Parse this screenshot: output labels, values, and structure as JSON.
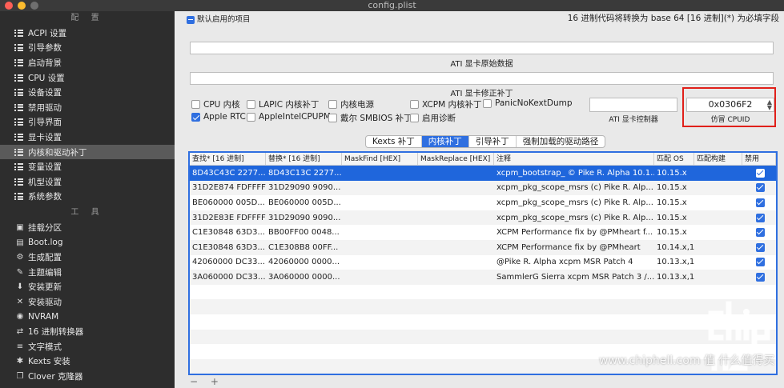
{
  "window": {
    "title": "config.plist"
  },
  "sidebar": {
    "section1_title": "配 置",
    "items": [
      {
        "label": "ACPI 设置"
      },
      {
        "label": "引导参数"
      },
      {
        "label": "启动背景"
      },
      {
        "label": "CPU 设置"
      },
      {
        "label": "设备设置"
      },
      {
        "label": "禁用驱动"
      },
      {
        "label": "引导界面"
      },
      {
        "label": "显卡设置"
      },
      {
        "label": "内核和驱动补丁",
        "active": true
      },
      {
        "label": "变量设置"
      },
      {
        "label": "机型设置"
      },
      {
        "label": "系统参数"
      }
    ],
    "section2_title": "工 具",
    "tools": [
      {
        "label": "挂载分区",
        "icon": "disk-icon"
      },
      {
        "label": "Boot.log",
        "icon": "document-icon"
      },
      {
        "label": "生成配置",
        "icon": "gears-icon"
      },
      {
        "label": "主题编辑",
        "icon": "palette-icon"
      },
      {
        "label": "安装更新",
        "icon": "download-icon"
      },
      {
        "label": "安装驱动",
        "icon": "wrench-icon"
      },
      {
        "label": "NVRAM",
        "icon": "chip-icon"
      },
      {
        "label": "16 进制转换器",
        "icon": "converter-icon"
      },
      {
        "label": "文字模式",
        "icon": "text-mode-icon"
      },
      {
        "label": "Kexts 安装",
        "icon": "kexts-icon"
      },
      {
        "label": "Clover 克隆器",
        "icon": "clone-icon"
      }
    ]
  },
  "topbar": {
    "default_items": "默认启用的项目",
    "hex_note": "16 进制代码将转换为 base 64 [16 进制](*) 为必填字段"
  },
  "ati": {
    "rom_caption": "ATI 显卡原始数据",
    "patch_caption": "ATI 显卡修正补丁",
    "controller_caption": "ATI 显卡控制器",
    "cpuid_caption": "仿冒 CPUID",
    "cpuid_value": "0x0306F2"
  },
  "options": [
    {
      "label": "CPU 内核",
      "checked": false
    },
    {
      "label": "LAPIC 内核补丁",
      "checked": false
    },
    {
      "label": "内核电源",
      "checked": false
    },
    {
      "label": "XCPM 内核补丁",
      "checked": false
    },
    {
      "label": "PanicNoKextDump",
      "checked": false
    },
    {
      "label": "Apple RTC",
      "checked": true
    },
    {
      "label": "AppleIntelCPUPM",
      "checked": false
    },
    {
      "label": "戴尔 SMBIOS 补丁",
      "checked": false
    },
    {
      "label": "启用诊断",
      "checked": false
    }
  ],
  "tabs": [
    {
      "label": "Kexts 补丁",
      "active": false
    },
    {
      "label": "内核补丁",
      "active": true
    },
    {
      "label": "引导补丁",
      "active": false
    },
    {
      "label": "强制加载的驱动路径",
      "active": false
    }
  ],
  "table": {
    "columns": [
      "查找* [16 进制]",
      "替换* [16 进制]",
      "MaskFind [HEX]",
      "MaskReplace [HEX]",
      "注释",
      "匹配 OS",
      "匹配构建",
      "禁用"
    ],
    "rows": [
      {
        "find": "8D43C43C 2277...",
        "replace": "8D43C13C 2277...",
        "maskfind": "",
        "maskreplace": "",
        "comment": "xcpm_bootstrap_ © Pike R. Alpha 10.1...",
        "os": "10.15.x",
        "build": "",
        "disabled": true,
        "selected": true
      },
      {
        "find": "31D2E874 FDFFFF",
        "replace": "31D29090 9090...",
        "maskfind": "",
        "maskreplace": "",
        "comment": "xcpm_pkg_scope_msrs (c) Pike R. Alp...",
        "os": "10.15.x",
        "build": "",
        "disabled": true
      },
      {
        "find": "BE060000 005D...",
        "replace": "BE060000 005D...",
        "maskfind": "",
        "maskreplace": "",
        "comment": "xcpm_pkg_scope_msrs (c) Pike R. Alp...",
        "os": "10.15.x",
        "build": "",
        "disabled": true
      },
      {
        "find": "31D2E83E FDFFFF",
        "replace": "31D29090 9090...",
        "maskfind": "",
        "maskreplace": "",
        "comment": "xcpm_pkg_scope_msrs (c) Pike R. Alp...",
        "os": "10.15.x",
        "build": "",
        "disabled": true
      },
      {
        "find": "C1E30848 63D3...",
        "replace": "BB00FF00 0048...",
        "maskfind": "",
        "maskreplace": "",
        "comment": "XCPM Performance fix by @PMheart f...",
        "os": "10.15.x",
        "build": "",
        "disabled": true
      },
      {
        "find": "C1E30848 63D3...",
        "replace": "C1E308B8 00FF...",
        "maskfind": "",
        "maskreplace": "",
        "comment": "XCPM Performance fix by @PMheart",
        "os": "10.14.x,1...",
        "build": "",
        "disabled": true
      },
      {
        "find": "42060000 DC33...",
        "replace": "42060000 0000...",
        "maskfind": "",
        "maskreplace": "",
        "comment": "@Pike R. Alpha xcpm MSR Patch 4",
        "os": "10.13.x,1...",
        "build": "",
        "disabled": true
      },
      {
        "find": "3A060000 DC33...",
        "replace": "3A060000 0000...",
        "maskfind": "",
        "maskreplace": "",
        "comment": "SammlerG Sierra xcpm MSR Patch 3 /...",
        "os": "10.13.x,1...",
        "build": "",
        "disabled": true
      }
    ]
  },
  "footer": {
    "add_remove": "− +"
  },
  "watermark": {
    "text": "www.chiphell.com  值 什么值得买"
  }
}
